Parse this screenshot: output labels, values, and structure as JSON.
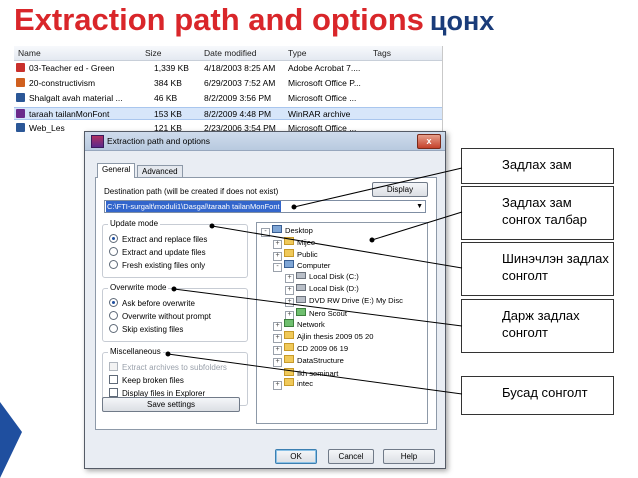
{
  "title": {
    "part1": "Extraction path and options",
    "part2": "цонх"
  },
  "explorer": {
    "columns": [
      "Name",
      "Size",
      "Date modified",
      "Type",
      "Tags"
    ],
    "rows": [
      {
        "name": "03-Teacher ed - Green",
        "size": "1,339 KB",
        "date": "4/18/2003 8:25 AM",
        "type": "Adobe Acrobat 7....",
        "icon_color": "#c9302c",
        "selected": false
      },
      {
        "name": "20-constructivism",
        "size": "384 KB",
        "date": "6/29/2003 7:52 AM",
        "type": "Microsoft Office P...",
        "icon_color": "#d0601f",
        "selected": false
      },
      {
        "name": "Shalgalt avah material ...",
        "size": "46 KB",
        "date": "8/2/2009 3:56 PM",
        "type": "Microsoft Office ...",
        "icon_color": "#2b5797",
        "selected": false
      },
      {
        "name": "taraah tailanMonFont",
        "size": "153 KB",
        "date": "8/2/2009 4:48 PM",
        "type": "WinRAR archive",
        "icon_color": "#6b2a8c",
        "selected": true
      },
      {
        "name": "Web_Les",
        "size": "121 KB",
        "date": "2/23/2006 3:54 PM",
        "type": "Microsoft Office ...",
        "icon_color": "#2b5797",
        "selected": false
      }
    ]
  },
  "dialog": {
    "title": "Extraction path and options",
    "close_glyph": "x",
    "tabs": [
      "General",
      "Advanced"
    ],
    "dest_label": "Destination path (will be created if does not exist)",
    "display_button": "Display",
    "dest_value": "C:\\FTI-surgalt\\moduli1\\Dasgal\\taraah tailanMonFont",
    "update_mode": {
      "title": "Update mode",
      "options": [
        "Extract and replace files",
        "Extract and update files",
        "Fresh existing files only"
      ],
      "selected": 0
    },
    "overwrite_mode": {
      "title": "Overwrite mode",
      "options": [
        "Ask before overwrite",
        "Overwrite without prompt",
        "Skip existing files"
      ],
      "selected": 0
    },
    "misc": {
      "title": "Miscellaneous",
      "options": [
        "Extract archives to subfolders",
        "Keep broken files",
        "Display files in Explorer"
      ]
    },
    "save_button": "Save settings",
    "tree": [
      {
        "label": "Desktop",
        "icon": "pc",
        "indent": 0,
        "expander": "-"
      },
      {
        "label": "Mijee",
        "icon": "folder",
        "indent": 1,
        "expander": "+"
      },
      {
        "label": "Public",
        "icon": "folder",
        "indent": 1,
        "expander": "+"
      },
      {
        "label": "Computer",
        "icon": "pc",
        "indent": 1,
        "expander": "-"
      },
      {
        "label": "Local Disk (C:)",
        "icon": "disk",
        "indent": 2,
        "expander": "+"
      },
      {
        "label": "Local Disk (D:)",
        "icon": "disk",
        "indent": 2,
        "expander": "+"
      },
      {
        "label": "DVD RW Drive (E:) My Disc",
        "icon": "disk",
        "indent": 2,
        "expander": "+"
      },
      {
        "label": "Nero Scout",
        "icon": "net",
        "indent": 2,
        "expander": "+"
      },
      {
        "label": "Network",
        "icon": "net",
        "indent": 1,
        "expander": "+"
      },
      {
        "label": "Ajlin thesis 2009 05 20",
        "icon": "folder",
        "indent": 1,
        "expander": "+"
      },
      {
        "label": "CD 2009 06 19",
        "icon": "folder",
        "indent": 1,
        "expander": "+"
      },
      {
        "label": "DataStructure",
        "icon": "folder",
        "indent": 1,
        "expander": "+"
      },
      {
        "label": "Ikh seminart",
        "icon": "folder",
        "indent": 1,
        "expander": ""
      },
      {
        "label": "intec",
        "icon": "folder",
        "indent": 1,
        "expander": "+"
      }
    ],
    "buttons": {
      "ok": "OK",
      "cancel": "Cancel",
      "help": "Help"
    }
  },
  "callouts": [
    "Задлах зам",
    "Задлах зам сонгох талбар",
    "Шинэчлэн задлах сонголт",
    "Дарж задлах сонголт",
    "Бусад сонголт"
  ],
  "colors": {
    "title_red": "#d9262a",
    "title_blue": "#1a3c7a",
    "selection": "#3366cc",
    "deco_blue": "#1f4f9f"
  }
}
